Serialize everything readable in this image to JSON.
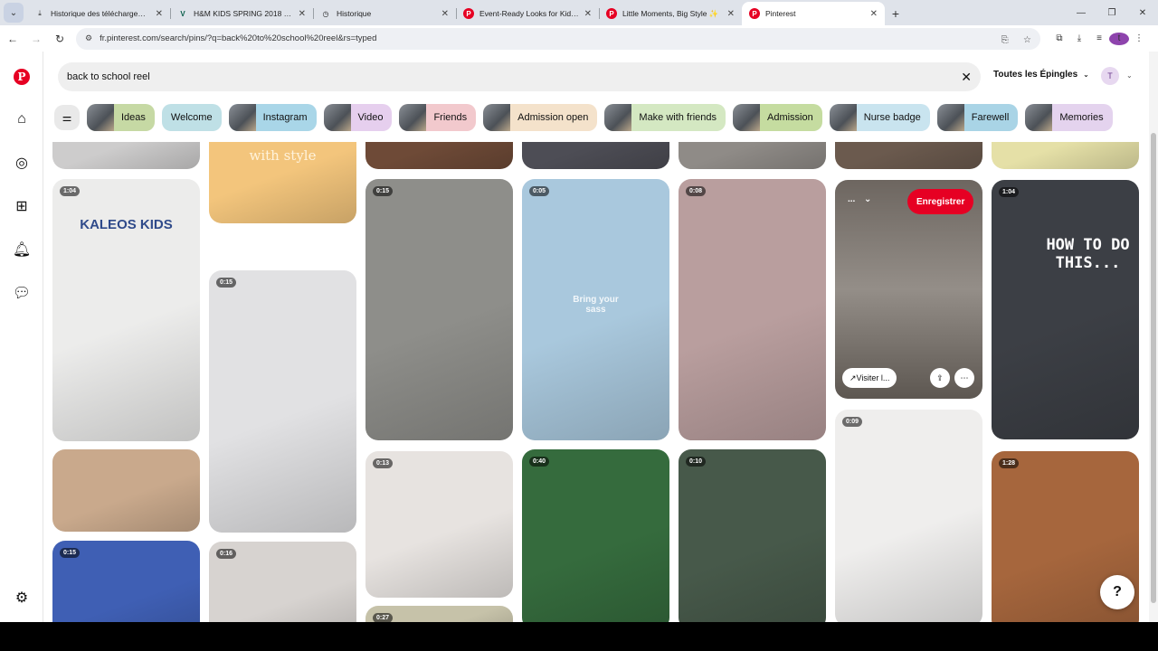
{
  "browser": {
    "tabs": [
      {
        "title": "Historique des téléchargements",
        "favicon": "download-icon",
        "active": false
      },
      {
        "title": "H&M KIDS SPRING 2018 sur Vi",
        "favicon": "vimeo-icon",
        "active": false
      },
      {
        "title": "Historique",
        "favicon": "history-icon",
        "active": false
      },
      {
        "title": "Event-Ready Looks for Kids 🎈 ✨",
        "favicon": "pinterest-icon",
        "active": false
      },
      {
        "title": "Little Moments, Big Style ✨",
        "favicon": "pinterest-icon",
        "active": false
      },
      {
        "title": "Pinterest",
        "favicon": "pinterest-icon",
        "active": true
      }
    ],
    "url": "fr.pinterest.com/search/pins/?q=back%20to%20school%20reel&rs=typed"
  },
  "search": {
    "query": "back to school reel",
    "scope_label": "Toutes les Épingles",
    "avatar_initial": "T"
  },
  "chips": [
    {
      "label": "Ideas",
      "bg": "#c6d9a4",
      "thumb": true
    },
    {
      "label": "Welcome",
      "bg": "#bfe0e6",
      "thumb": false
    },
    {
      "label": "Instagram",
      "bg": "#a9d6e8",
      "thumb": true
    },
    {
      "label": "Video",
      "bg": "#e6cfee",
      "thumb": true
    },
    {
      "label": "Friends",
      "bg": "#f2c9cd",
      "thumb": true
    },
    {
      "label": "Admission open",
      "bg": "#f4e2cb",
      "thumb": true
    },
    {
      "label": "Make with friends",
      "bg": "#d4e8c2",
      "thumb": true
    },
    {
      "label": "Admission",
      "bg": "#c5dca0",
      "thumb": true
    },
    {
      "label": "Nurse badge",
      "bg": "#c9e4ef",
      "thumb": true
    },
    {
      "label": "Farewell",
      "bg": "#a9d4e6",
      "thumb": true
    },
    {
      "label": "Memories",
      "bg": "#e4d3ee",
      "thumb": true
    }
  ],
  "pins": [
    {
      "col": 0,
      "duration": "",
      "text": "",
      "bg": "#cdcccc"
    },
    {
      "col": 0,
      "duration": "1:04",
      "text": "KALEOS KIDS",
      "bg": "#ececeb"
    },
    {
      "col": 0,
      "duration": "",
      "text": "",
      "bg": "#c9a98c"
    },
    {
      "col": 0,
      "duration": "0:15",
      "text": "",
      "bg": "#3f5fb4"
    },
    {
      "col": 1,
      "duration": "",
      "text": "with style",
      "bg": "#f3c57c"
    },
    {
      "col": 1,
      "duration": "0:15",
      "text": "",
      "bg": "#e1e1e3"
    },
    {
      "col": 1,
      "duration": "0:16",
      "text": "",
      "bg": "#d7d3d0"
    },
    {
      "col": 2,
      "duration": "",
      "text": "",
      "bg": "#6e4a37"
    },
    {
      "col": 2,
      "duration": "0:15",
      "text": "",
      "bg": "#8e8e8a"
    },
    {
      "col": 2,
      "duration": "0:13",
      "text": "",
      "bg": "#e7e3e0"
    },
    {
      "col": 2,
      "duration": "0:27",
      "text": "",
      "bg": "#c6c2a9"
    },
    {
      "col": 3,
      "duration": "",
      "text": "",
      "bg": "#4d4d55"
    },
    {
      "col": 3,
      "duration": "0:05",
      "text": "Bring your sass",
      "bg": "#a9c8dd"
    },
    {
      "col": 3,
      "duration": "0:40",
      "text": "",
      "bg": "#356b3d"
    },
    {
      "col": 4,
      "duration": "",
      "text": "",
      "bg": "#8f8b87"
    },
    {
      "col": 4,
      "duration": "0:08",
      "text": "",
      "bg": "#b99e9e"
    },
    {
      "col": 4,
      "duration": "0:10",
      "text": "",
      "bg": "#47594a"
    },
    {
      "col": 5,
      "duration": "",
      "text": "",
      "bg": "#6b5a4e"
    },
    {
      "col": 5,
      "duration": "",
      "text": "",
      "bg": "#8d8a87",
      "hover": true
    },
    {
      "col": 5,
      "duration": "0:09",
      "text": "",
      "bg": "#efeeed"
    },
    {
      "col": 6,
      "duration": "",
      "text": "",
      "bg": "#e5e0a7"
    },
    {
      "col": 6,
      "duration": "1:04",
      "text": "HOW TO DO THIS...",
      "bg": "#3c3f45"
    },
    {
      "col": 6,
      "duration": "1:28",
      "text": "",
      "bg": "#a6663d"
    }
  ],
  "hover_pin": {
    "save_label": "Enregistrer",
    "visit_label": "Visiter l...",
    "more_label": "...",
    "board_chevron": "⌄"
  },
  "help_label": "?"
}
